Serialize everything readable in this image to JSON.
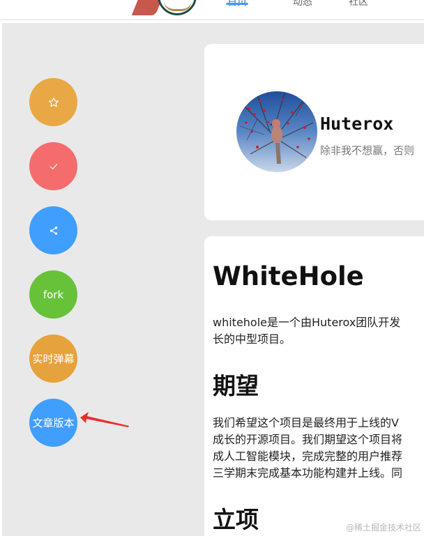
{
  "header": {
    "nav": [
      "首页",
      "动态",
      "社区"
    ]
  },
  "float_buttons": {
    "favorite": {
      "icon": "star-outline-icon"
    },
    "like": {
      "icon": "check-icon"
    },
    "share": {
      "icon": "share-icon"
    },
    "fork": {
      "label": "fork"
    },
    "danmu": {
      "label": "实时弹幕"
    },
    "version": {
      "label": "文章版本"
    }
  },
  "profile": {
    "name": "Huterox",
    "motto": "除非我不想赢，否则"
  },
  "article": {
    "title": "WhiteHole",
    "paragraph1": [
      "whitehole是一个由Huterox团队开发",
      "长的中型项目。"
    ],
    "h_expect": "期望",
    "paragraph2": [
      "我们希望这个项目是最终用于上线的V",
      "成长的开源项目。我们期望这个项目将",
      "成人工智能模块，完成完整的用户推荐",
      "三学期末完成基本功能构建并上线。同"
    ],
    "h_project": "立项"
  },
  "watermark": "@稀土掘金技术社区",
  "colors": {
    "orange": "#e8a845",
    "red": "#f56c6c",
    "blue": "#409eff",
    "green": "#67c23a",
    "amber": "#e6a23c",
    "annotation_arrow": "#e8302a"
  }
}
